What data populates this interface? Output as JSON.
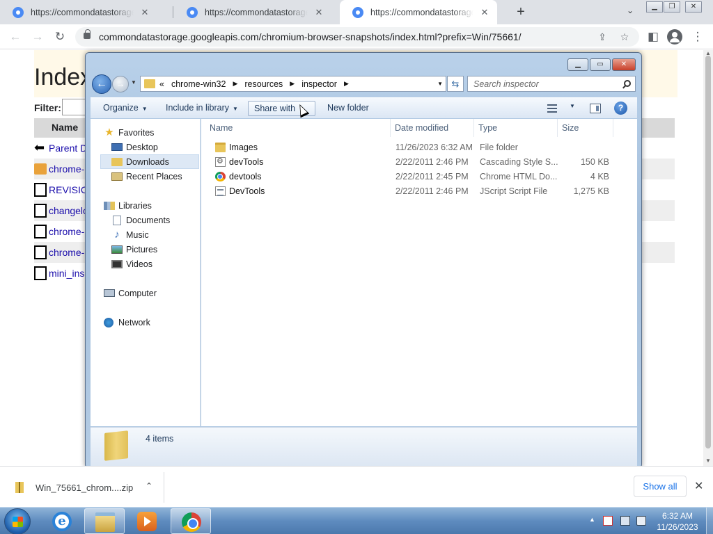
{
  "browser": {
    "tabs": [
      {
        "title": "https://commondatastorage.goo",
        "active": false
      },
      {
        "title": "https://commondatastorage.goo",
        "active": false
      },
      {
        "title": "https://commondatastorage.goo",
        "active": true
      }
    ],
    "tab_close_glyph": "✕",
    "new_tab_glyph": "+",
    "address": "commondatastorage.googleapis.com/chromium-browser-snapshots/index.html?prefix=Win/75661/"
  },
  "webpage": {
    "title": "Index",
    "filter_label": "Filter:",
    "column_name": "Name",
    "rows": [
      {
        "label": "Parent D",
        "icon": "back-icon"
      },
      {
        "label": "chrome-",
        "icon": "folder-icon"
      },
      {
        "label": "REVISIC",
        "icon": "binary-file-icon"
      },
      {
        "label": "changelo",
        "icon": "binary-file-icon"
      },
      {
        "label": "chrome-",
        "icon": "binary-file-icon"
      },
      {
        "label": "chrome-",
        "icon": "binary-file-icon"
      },
      {
        "label": "mini_ins",
        "icon": "binary-file-icon"
      }
    ]
  },
  "explorer": {
    "breadcrumb": [
      "«",
      "chrome-win32",
      "resources",
      "inspector"
    ],
    "search_placeholder": "Search inspector",
    "commands": {
      "organize": "Organize",
      "include_in_library": "Include in library",
      "share_with": "Share with",
      "new_folder": "New folder"
    },
    "help_glyph": "?",
    "nav": {
      "favorites": "Favorites",
      "desktop": "Desktop",
      "downloads": "Downloads",
      "recent_places": "Recent Places",
      "libraries": "Libraries",
      "documents": "Documents",
      "music": "Music",
      "pictures": "Pictures",
      "videos": "Videos",
      "computer": "Computer",
      "network": "Network"
    },
    "columns": {
      "name": "Name",
      "date_modified": "Date modified",
      "type": "Type",
      "size": "Size"
    },
    "files": [
      {
        "name": "Images",
        "date": "11/26/2023 6:32 AM",
        "type": "File folder",
        "size": "",
        "icon": "folder-icon"
      },
      {
        "name": "devTools",
        "date": "2/22/2011 2:46 PM",
        "type": "Cascading Style S...",
        "size": "150 KB",
        "icon": "css-file-icon"
      },
      {
        "name": "devtools",
        "date": "2/22/2011 2:45 PM",
        "type": "Chrome HTML Do...",
        "size": "4 KB",
        "icon": "chrome-html-icon"
      },
      {
        "name": "DevTools",
        "date": "2/22/2011 2:46 PM",
        "type": "JScript Script File",
        "size": "1,275 KB",
        "icon": "jscript-file-icon"
      }
    ],
    "item_count": "4 items"
  },
  "download_shelf": {
    "filename": "Win_75661_chrom....zip",
    "show_all": "Show all"
  },
  "taskbar": {
    "time": "6:32 AM",
    "date": "11/26/2023"
  }
}
